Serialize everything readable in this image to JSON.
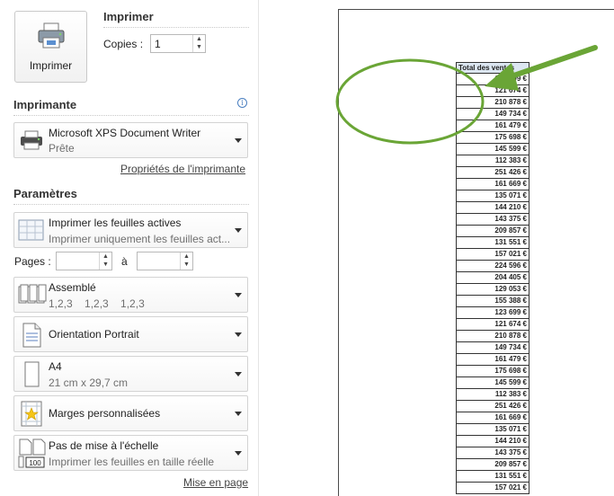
{
  "print": {
    "button_label": "Imprimer",
    "title": "Imprimer",
    "copies_label": "Copies :",
    "copies_value": "1"
  },
  "printer": {
    "section_title": "Imprimante",
    "name": "Microsoft XPS Document Writer",
    "status": "Prête",
    "properties_link": "Propriétés de l'imprimante"
  },
  "settings": {
    "section_title": "Paramètres",
    "what": {
      "title": "Imprimer les feuilles actives",
      "subtitle": "Imprimer uniquement les feuilles act..."
    },
    "pages_label": "Pages :",
    "to_label": "à",
    "pages_from": "",
    "pages_to": "",
    "collate": {
      "title": "Assemblé",
      "subtitle": "1,2,3    1,2,3    1,2,3"
    },
    "orientation": {
      "title": "Orientation Portrait"
    },
    "paper": {
      "title": "A4",
      "subtitle": "21 cm x 29,7 cm"
    },
    "margins": {
      "title": "Marges personnalisées"
    },
    "scaling": {
      "title": "Pas de mise à l'échelle",
      "subtitle": "Imprimer les feuilles en taille réelle"
    },
    "page_setup_link": "Mise en page"
  },
  "preview": {
    "header": "Total des ventes",
    "values": [
      "123 699 €",
      "121 674 €",
      "210 878 €",
      "149 734 €",
      "161 479 €",
      "175 698 €",
      "145 599 €",
      "112 383 €",
      "251 426 €",
      "161 669 €",
      "135 071 €",
      "144 210 €",
      "143 375 €",
      "209 857 €",
      "131 551 €",
      "157 021 €",
      "224 596 €",
      "204 405 €",
      "129 053 €",
      "155 388 €",
      "123 699 €",
      "121 674 €",
      "210 878 €",
      "149 734 €",
      "161 479 €",
      "175 698 €",
      "145 599 €",
      "112 383 €",
      "251 426 €",
      "161 669 €",
      "135 071 €",
      "144 210 €",
      "143 375 €",
      "209 857 €",
      "131 551 €",
      "157 021 €"
    ]
  },
  "colors": {
    "annotation": "#6aa536",
    "header_fill": "#dce6f1"
  }
}
